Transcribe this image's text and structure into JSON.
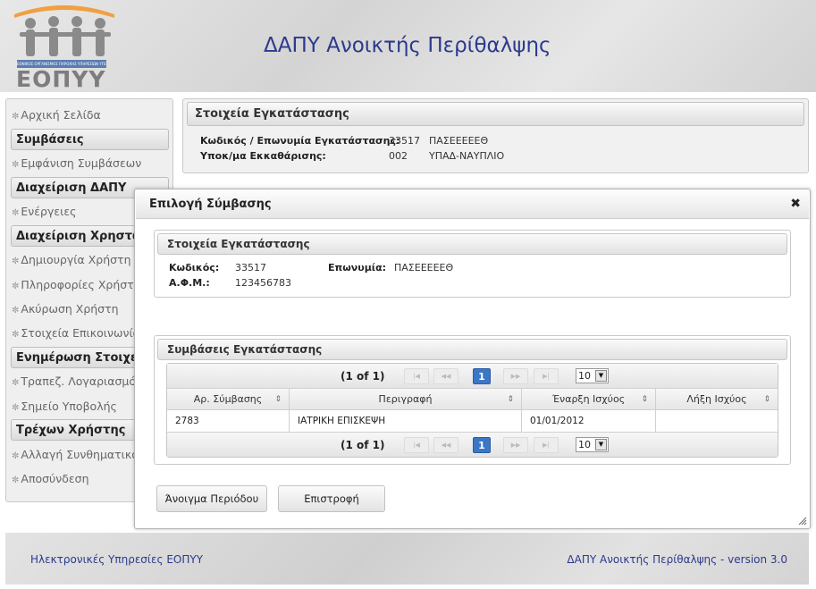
{
  "header": {
    "app_title": "ΔΑΠΥ Ανοικτής Περίθαλψης",
    "logo_text": "ΕΟΠΥΥ",
    "logo_subtitle": "ΕΘΝΙΚΟΣ ΟΡΓΑΝΙΣΜΟΣ ΠΑΡΟΧΗΣ ΥΠΗΡΕΣΙΩΝ ΥΓΕΙΑΣ"
  },
  "sidebar": {
    "items": [
      {
        "type": "link",
        "label": "Αρχική Σελίδα"
      },
      {
        "type": "header",
        "label": "Συμβάσεις"
      },
      {
        "type": "link",
        "label": "Εμφάνιση Συμβάσεων"
      },
      {
        "type": "header",
        "label": "Διαχείριση ΔΑΠΥ"
      },
      {
        "type": "link",
        "label": "Ενέργειες"
      },
      {
        "type": "header",
        "label": "Διαχείριση Χρηστών"
      },
      {
        "type": "link",
        "label": "Δημιουργία Χρήστη"
      },
      {
        "type": "link",
        "label": "Πληροφορίες Χρήστη"
      },
      {
        "type": "link",
        "label": "Ακύρωση Χρήστη"
      },
      {
        "type": "link",
        "label": "Στοιχεία Επικοινωνίας"
      },
      {
        "type": "header",
        "label": "Ενημέρωση Στοιχείων"
      },
      {
        "type": "link",
        "label": "Τραπεζ. Λογαριασμός"
      },
      {
        "type": "link",
        "label": "Σημείο Υποβολής"
      },
      {
        "type": "header",
        "label": "Τρέχων Χρήστης"
      },
      {
        "type": "link",
        "label": "Αλλαγή Συνθηματικού"
      },
      {
        "type": "link",
        "label": "Αποσύνδεση"
      }
    ]
  },
  "main_panel": {
    "title": "Στοιχεία Εγκατάστασης",
    "facility_label": "Κωδικός / Επωνυμία Εγκατάστασης:",
    "facility_code": "33517",
    "facility_name": "ΠΑΣΕΕΕΕΕΘ",
    "clearing_label": "Υποκ/μα Εκκαθάρισης:",
    "clearing_code": "002",
    "clearing_name": "ΥΠΑΔ-ΝΑΥΠΛΙΟ"
  },
  "dialog": {
    "title": "Επιλογή Σύμβασης",
    "close_glyph": "✖",
    "facility_section": {
      "title": "Στοιχεία Εγκατάστασης",
      "code_label": "Κωδικός:",
      "code_value": "33517",
      "name_label": "Επωνυμία:",
      "name_value": "ΠΑΣΕΕΕΕΕΘ",
      "afm_label": "Α.Φ.Μ.:",
      "afm_value": "123456783"
    },
    "contracts_section": {
      "title": "Συμβάσεις Εγκατάστασης",
      "pager": {
        "page_text": "(1 of 1)",
        "current_page": "1",
        "rows_per_page": "10",
        "first_glyph": "|◀",
        "prev_glyph": "◀◀",
        "next_glyph": "▶▶",
        "last_glyph": "▶|"
      },
      "columns": [
        "Αρ. Σύμβασης",
        "Περιγραφή",
        "Έναρξη Ισχύος",
        "Λήξη Ισχύος"
      ],
      "rows": [
        [
          "2783",
          "ΙΑΤΡΙΚΗ ΕΠΙΣΚΕΨΗ",
          "01/01/2012",
          ""
        ]
      ]
    },
    "buttons": {
      "open_period": "Άνοιγμα Περιόδου",
      "back": "Επιστροφή"
    }
  },
  "footer": {
    "left": "Ηλεκτρονικές Υπηρεσίες ΕΟΠΥΥ",
    "right": "ΔΑΠΥ Ανοικτής Περίθαλψης - version 3.0"
  }
}
